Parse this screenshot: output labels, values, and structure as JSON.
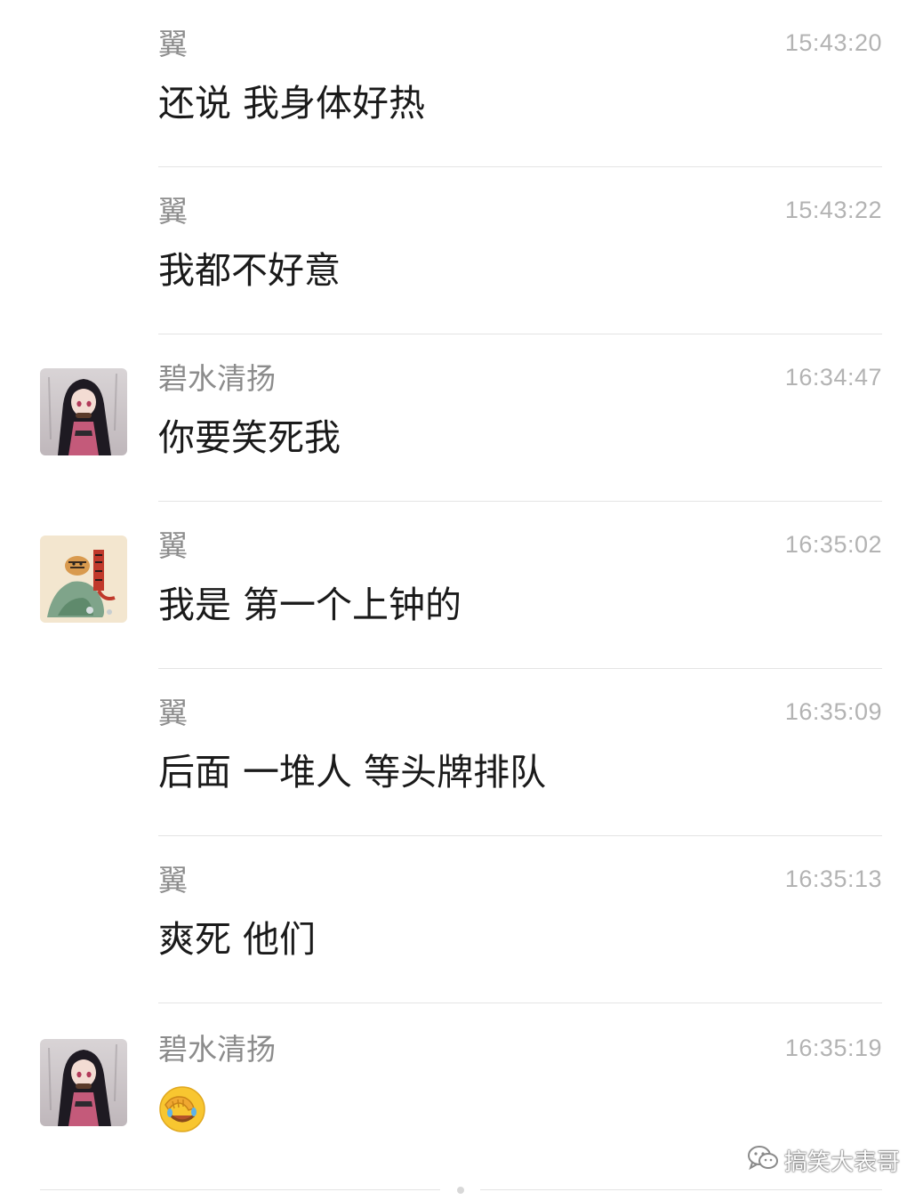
{
  "messages": [
    {
      "sender": "翼",
      "time": "15:43:20",
      "text": "还说 我身体好热",
      "avatar": "none"
    },
    {
      "sender": "翼",
      "time": "15:43:22",
      "text": "我都不好意",
      "avatar": "none"
    },
    {
      "sender": "碧水清扬",
      "time": "16:34:47",
      "text": "你要笑死我",
      "avatar": "anime-girl-avatar"
    },
    {
      "sender": "翼",
      "time": "16:35:02",
      "text": "我是 第一个上钟的",
      "avatar": "tiger-painting-avatar"
    },
    {
      "sender": "翼",
      "time": "16:35:09",
      "text": "后面 一堆人 等头牌排队",
      "avatar": "none"
    },
    {
      "sender": "翼",
      "time": "16:35:13",
      "text": "爽死 他们",
      "avatar": "none"
    },
    {
      "sender": "碧水清扬",
      "time": "16:35:19",
      "text": "",
      "emoji": "facepalm-laughing-emoji-icon",
      "avatar": "anime-girl-avatar"
    }
  ],
  "watermark": {
    "text": "搞笑大表哥",
    "icon": "wechat-icon"
  },
  "colors": {
    "sender": "#8c8c8c",
    "time": "#b3b3b3",
    "text": "#1a1a1a",
    "divider": "#e4e4e4"
  }
}
